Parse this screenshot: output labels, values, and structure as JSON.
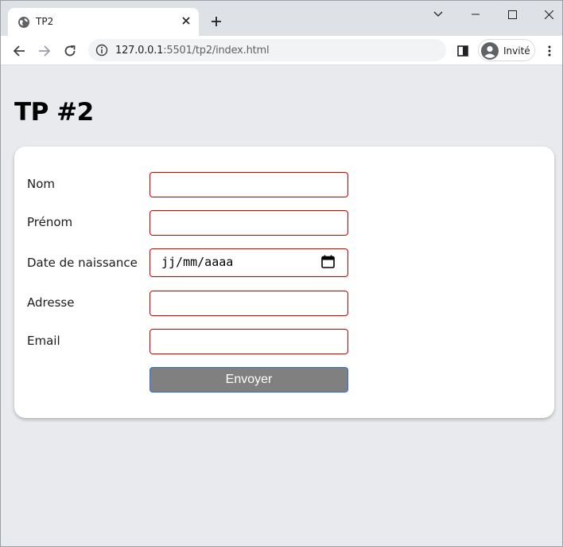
{
  "browser": {
    "tab_title": "TP2",
    "url_host": "127.0.0.1",
    "url_rest": ":5501/tp2/index.html",
    "profile_label": "Invité"
  },
  "page": {
    "title": "TP #2"
  },
  "form": {
    "fields": [
      {
        "label": "Nom",
        "value": ""
      },
      {
        "label": "Prénom",
        "value": ""
      },
      {
        "label": "Date de naissance",
        "placeholder": "jj/mm/aaaa"
      },
      {
        "label": "Adresse",
        "value": ""
      },
      {
        "label": "Email",
        "value": ""
      }
    ],
    "submit_label": "Envoyer"
  },
  "colors": {
    "input_border": "#d40000",
    "button_bg": "#808080",
    "button_border": "#2d6fd6",
    "page_bg": "#e9eaed"
  },
  "icons": [
    "globe-icon",
    "close-icon",
    "plus-icon",
    "chevron-down-icon",
    "minimize-icon",
    "maximize-icon",
    "window-close-icon",
    "back-arrow-icon",
    "forward-arrow-icon",
    "reload-icon",
    "info-icon",
    "side-panel-icon",
    "profile-avatar-icon",
    "kebab-menu-icon",
    "calendar-icon"
  ]
}
